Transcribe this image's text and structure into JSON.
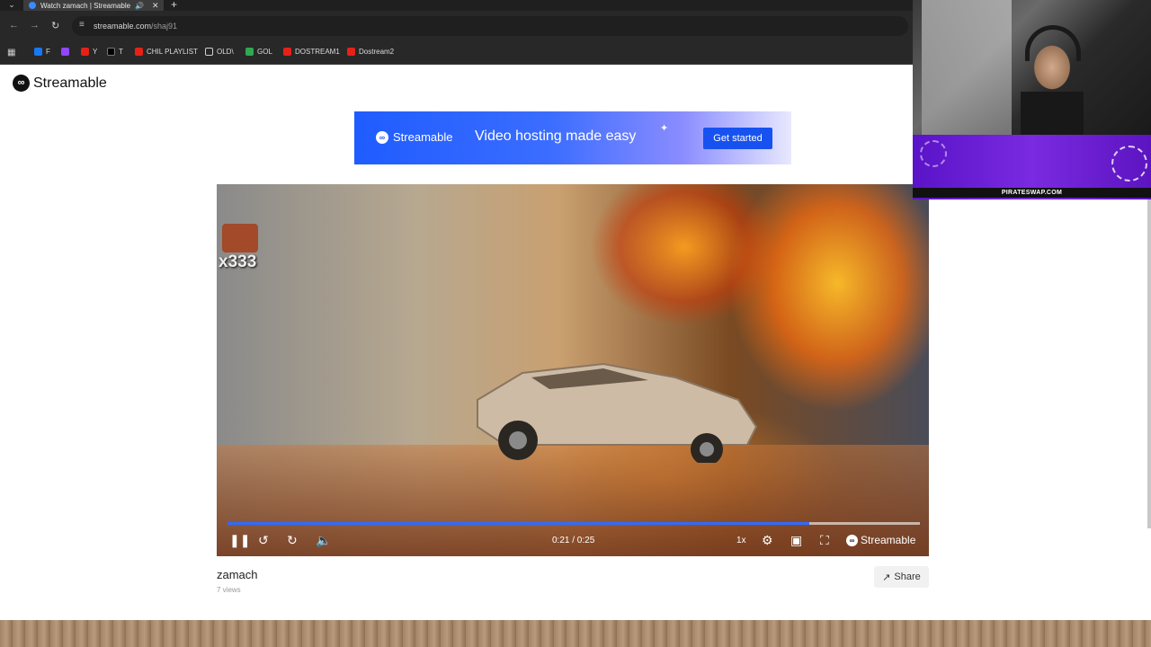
{
  "browser": {
    "tab": {
      "title": "Watch zamach | Streamable",
      "audio_icon": "speaker-icon",
      "close_icon": "close-icon"
    },
    "new_tab_icon": "plus-icon",
    "nav": {
      "back_icon": "back-arrow-icon",
      "forward_icon": "forward-arrow-icon",
      "reload_icon": "reload-icon"
    },
    "url": {
      "host": "streamable.com",
      "path": "/shaj91"
    },
    "bookmarks": [
      {
        "label": "F",
        "icon": "facebook-icon"
      },
      {
        "label": "",
        "icon": "twitch-icon"
      },
      {
        "label": "Y",
        "icon": "youtube-icon"
      },
      {
        "label": "T",
        "icon": "x-icon"
      },
      {
        "label": "CHIL PLAYLIST",
        "icon": "youtube-icon"
      },
      {
        "label": "OLD\\",
        "icon": "folder-icon"
      },
      {
        "label": "GOL",
        "icon": "gol-icon"
      },
      {
        "label": "DOSTREAM1",
        "icon": "youtube-icon"
      },
      {
        "label": "Dostream2",
        "icon": "youtube-icon"
      }
    ]
  },
  "site": {
    "logo_text": "Streamable",
    "banner": {
      "brand": "Streamable",
      "tagline": "Video hosting made easy",
      "cta": "Get started"
    }
  },
  "player": {
    "emote_count": "x333",
    "progress": 0.84,
    "time": "0:21 / 0:25",
    "speed": "1x",
    "brand": "Streamable",
    "icons": [
      "pause-icon",
      "rewind-icon",
      "forward-icon",
      "volume-icon",
      "settings-icon",
      "miniplayer-icon",
      "fullscreen-icon"
    ]
  },
  "video": {
    "title": "zamach",
    "views": "7 views",
    "share_label": "Share"
  },
  "overlay": {
    "promo_text": "PIRATESWAP.COM"
  },
  "colors": {
    "accent": "#2f6bff",
    "banner_cta": "#1752f0",
    "promo": "#6a1fd4"
  }
}
